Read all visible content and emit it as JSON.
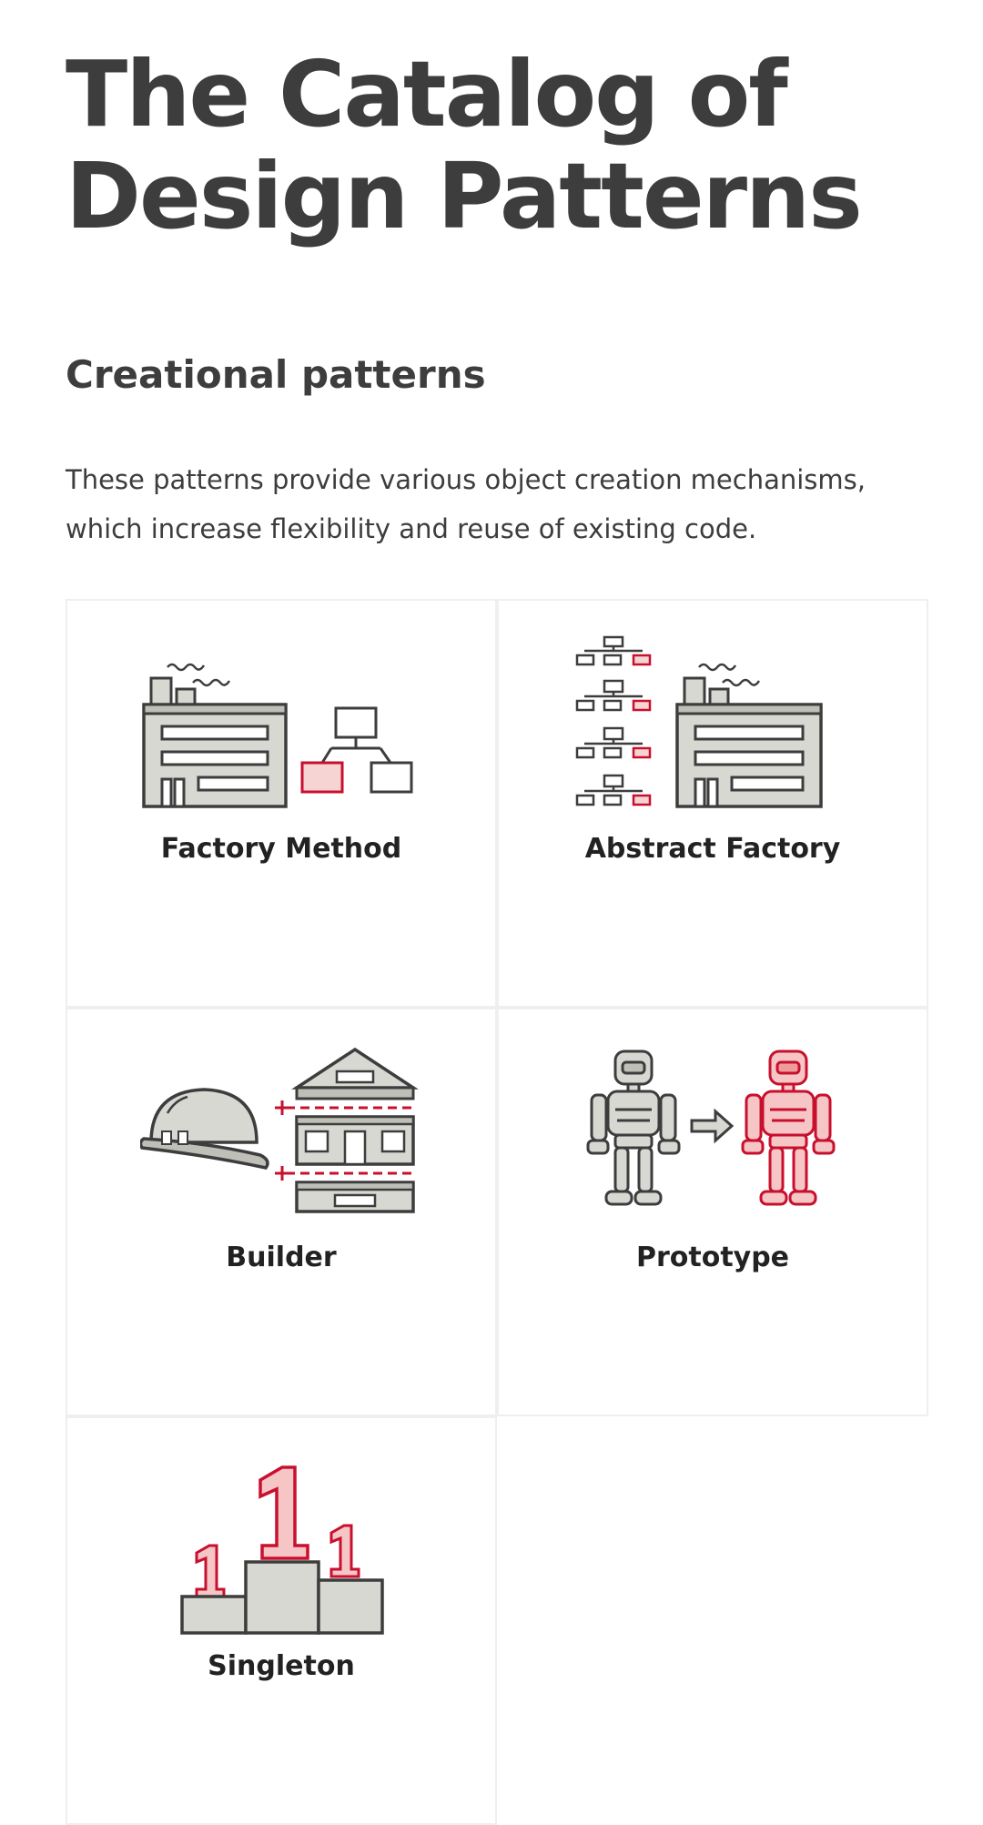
{
  "page": {
    "title_line1": "The Catalog of",
    "title_line2": "Design Patterns"
  },
  "section": {
    "title": "Creational patterns",
    "description_line1": "These patterns provide various object creation mechanisms,",
    "description_line2": "which increase flexibility and reuse of existing code."
  },
  "patterns": [
    {
      "label": "Factory Method",
      "icon": "factory-method-icon"
    },
    {
      "label": "Abstract Factory",
      "icon": "abstract-factory-icon"
    },
    {
      "label": "Builder",
      "icon": "builder-icon"
    },
    {
      "label": "Prototype",
      "icon": "prototype-icon"
    },
    {
      "label": "Singleton",
      "icon": "singleton-icon"
    }
  ],
  "colors": {
    "text": "#3d3d3d",
    "accent": "#c8102e",
    "illustration_fill": "#d8d8d2",
    "card_border": "#efefef"
  }
}
